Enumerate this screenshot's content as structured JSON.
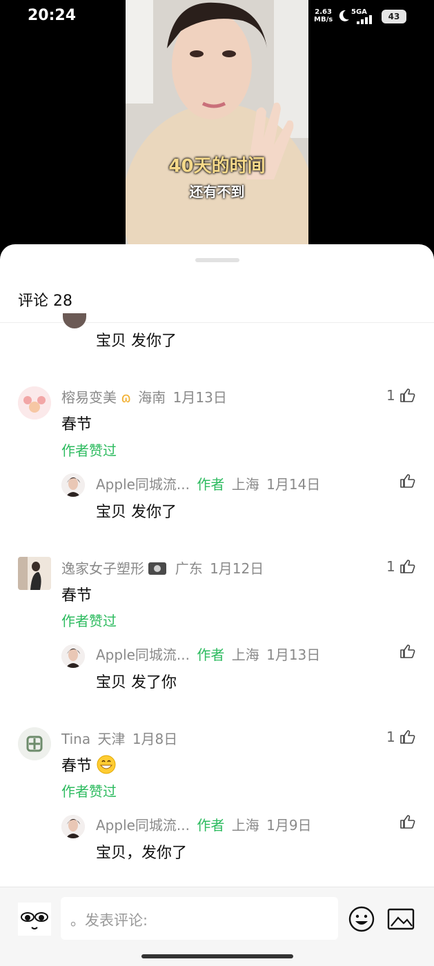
{
  "status": {
    "time": "20:24",
    "speed_value": "2.63",
    "speed_unit": "MB/s",
    "network": "5GA",
    "battery": "43"
  },
  "video": {
    "caption_main": "40天的时间",
    "caption_sub": "还有不到"
  },
  "comments_header": {
    "title": "评论 28"
  },
  "partial_reply": {
    "text": "宝贝 发你了"
  },
  "comments": [
    {
      "name": "榕易变美",
      "region": "海南",
      "date": "1月13日",
      "likes": "1",
      "text": "春节",
      "author_liked": "作者赞过",
      "reply": {
        "name": "Apple同城流...",
        "tag": "作者",
        "region": "上海",
        "date": "1月14日",
        "text": "宝贝 发你了"
      }
    },
    {
      "name": "逸家女子塑形",
      "region": "广东",
      "date": "1月12日",
      "likes": "1",
      "text": "春节",
      "author_liked": "作者赞过",
      "reply": {
        "name": "Apple同城流...",
        "tag": "作者",
        "region": "上海",
        "date": "1月13日",
        "text": "宝贝 发了你"
      }
    },
    {
      "name": "Tina",
      "region": "天津",
      "date": "1月8日",
      "likes": "1",
      "text": "春节",
      "author_liked": "作者赞过",
      "reply": {
        "name": "Apple同城流...",
        "tag": "作者",
        "region": "上海",
        "date": "1月9日",
        "text": "宝贝，发你了"
      }
    }
  ],
  "composer": {
    "placeholder": "。发表评论:"
  },
  "icons": {
    "like": "thumbs-up-icon",
    "emoji": "smiley-icon",
    "image": "image-icon",
    "sticker": "eyes-icon"
  },
  "colors": {
    "accent": "#2dbb5f"
  }
}
